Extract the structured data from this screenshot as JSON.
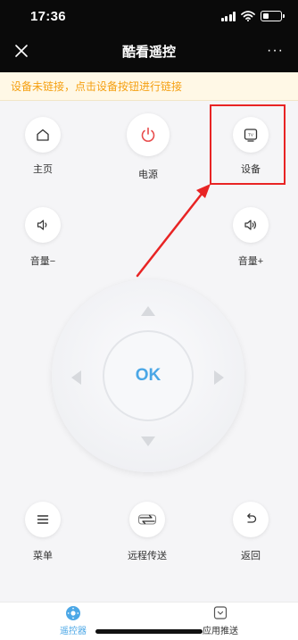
{
  "status_bar": {
    "time": "17:36"
  },
  "header": {
    "title": "酷看遥控",
    "more": "···"
  },
  "notice": {
    "text": "设备未链接，点击设备按钮进行链接"
  },
  "buttons": {
    "home": "主页",
    "power": "电源",
    "device": "设备",
    "device_tv": "TV",
    "vol_down": "音量−",
    "vol_up": "音量+",
    "menu": "菜单",
    "remote_transfer": "远程传送",
    "back": "返回"
  },
  "dpad": {
    "ok": "OK"
  },
  "tabs": [
    {
      "label": "遥控器",
      "active": true
    },
    {
      "label": "应用推送",
      "active": false
    }
  ],
  "colors": {
    "accent": "#4ba7e6",
    "notice_text": "#f5a012",
    "power_red": "#e84c4c",
    "highlight": "#e82424"
  }
}
